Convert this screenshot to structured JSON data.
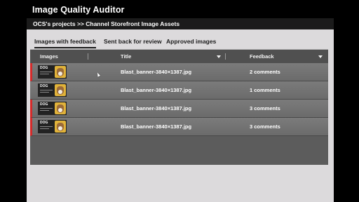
{
  "app": {
    "title": "Image Quality Auditor"
  },
  "breadcrumb": "OCS's projects >> Channel Storefront Image Assets",
  "tabs": [
    {
      "label": "Images with feedback",
      "active": true
    },
    {
      "label": "Sent back for review",
      "active": false
    },
    {
      "label": "Approved images",
      "active": false
    }
  ],
  "table": {
    "headers": {
      "images": "Images",
      "title": "Title",
      "feedback": "Feedback"
    },
    "rows": [
      {
        "thumb_text": "DOG",
        "title": "Blast_banner-3840×1387.jpg",
        "feedback": "2 comments",
        "flagged": true
      },
      {
        "thumb_text": "DOG",
        "title": "Blast_banner-3840×1387.jpg",
        "feedback": "1 comments",
        "flagged": false
      },
      {
        "thumb_text": "DOG",
        "title": "Blast_banner-3840×1387.jpg",
        "feedback": "3 comments",
        "flagged": true
      },
      {
        "thumb_text": "DOG",
        "title": "Blast_banner-3840×1387.jpg",
        "feedback": "3 comments",
        "flagged": true
      }
    ]
  },
  "colors": {
    "flag": "#d42a2a",
    "panel": "#dcdadc",
    "row": "#737373"
  }
}
